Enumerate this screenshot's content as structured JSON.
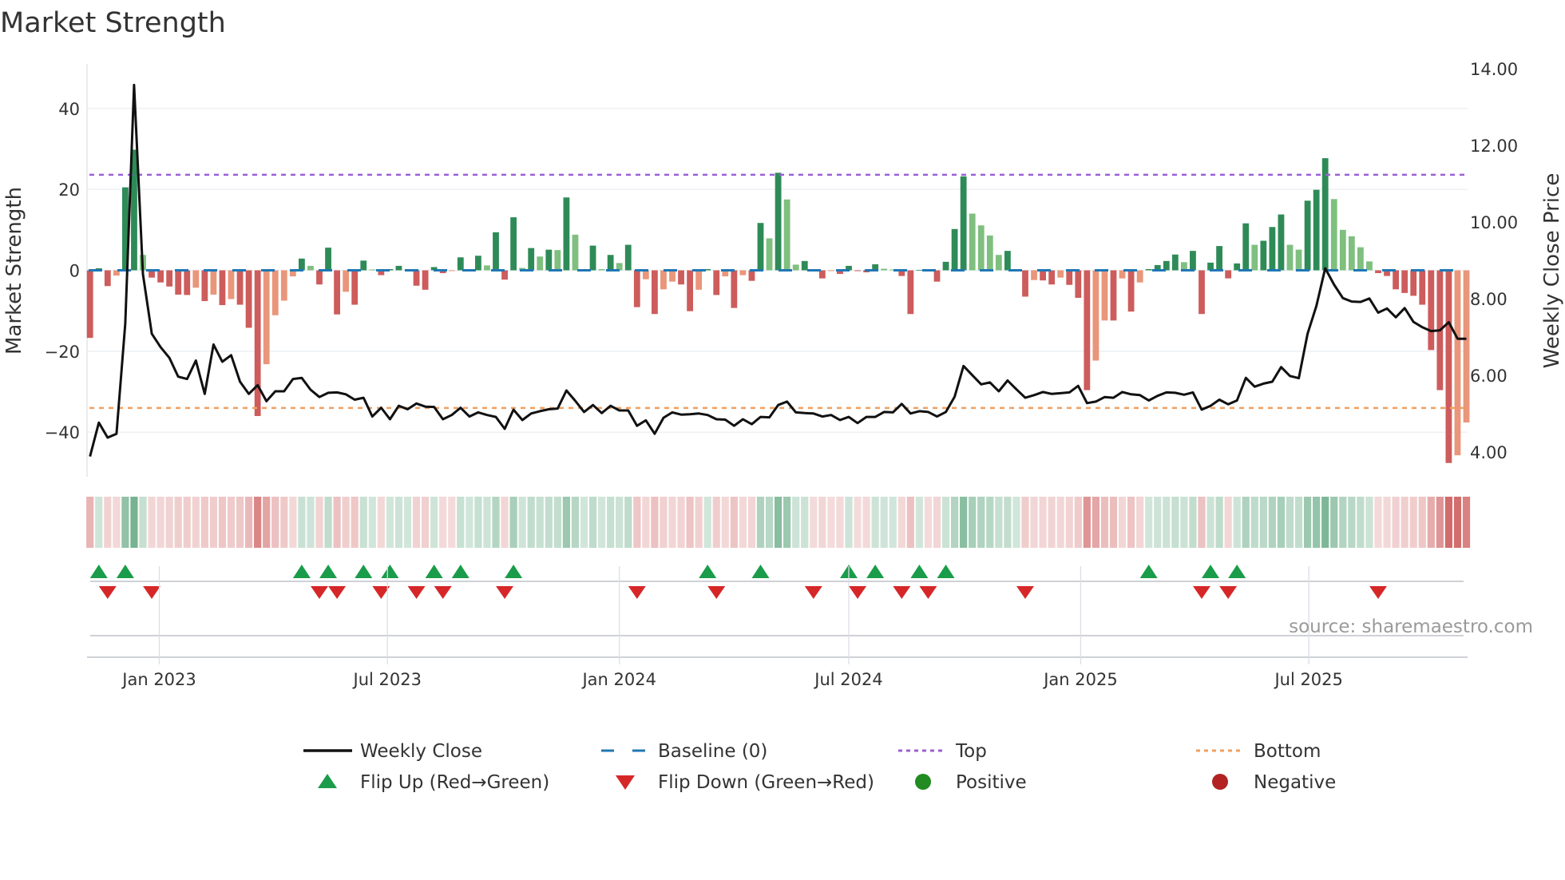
{
  "chart_data": {
    "type": "bar",
    "title": "Market Strength",
    "ylabel": "Market Strength",
    "ylabel_right": "Weekly Close Price",
    "ylim": [
      -51,
      51
    ],
    "ylim_right": [
      3.35,
      14.12
    ],
    "yticks": [
      {
        "value": 40,
        "label": "40"
      },
      {
        "value": 20,
        "label": "20"
      },
      {
        "value": 0,
        "label": "0"
      },
      {
        "value": -20,
        "label": "−20"
      },
      {
        "value": -40,
        "label": "−40"
      }
    ],
    "yticks_right": [
      {
        "value": 14,
        "label": "14.00"
      },
      {
        "value": 12,
        "label": "12.00"
      },
      {
        "value": 10,
        "label": "10.00"
      },
      {
        "value": 8,
        "label": "8.00"
      },
      {
        "value": 6,
        "label": "6.00"
      },
      {
        "value": 4,
        "label": "4.00"
      }
    ],
    "xticks": [
      {
        "date": "2023-01-01",
        "label": "Jan 2023"
      },
      {
        "date": "2023-07-01",
        "label": "Jul 2023"
      },
      {
        "date": "2024-01-01",
        "label": "Jan 2024"
      },
      {
        "date": "2024-07-01",
        "label": "Jul 2024"
      },
      {
        "date": "2025-01-01",
        "label": "Jan 2025"
      },
      {
        "date": "2025-07-01",
        "label": "Jul 2025"
      }
    ],
    "grid": true,
    "legend_position": "bottom",
    "top_level": 23.6,
    "bottom_level": -34.0,
    "baseline_level": 0,
    "weeks": [
      "2022-11-07",
      "2022-11-14",
      "2022-11-21",
      "2022-11-28",
      "2022-12-05",
      "2022-12-12",
      "2022-12-19",
      "2022-12-26",
      "2023-01-02",
      "2023-01-09",
      "2023-01-16",
      "2023-01-23",
      "2023-01-30",
      "2023-02-06",
      "2023-02-13",
      "2023-02-20",
      "2023-02-27",
      "2023-03-06",
      "2023-03-13",
      "2023-03-20",
      "2023-03-27",
      "2023-04-03",
      "2023-04-10",
      "2023-04-17",
      "2023-04-24",
      "2023-05-01",
      "2023-05-08",
      "2023-05-15",
      "2023-05-22",
      "2023-05-29",
      "2023-06-05",
      "2023-06-12",
      "2023-06-19",
      "2023-06-26",
      "2023-07-03",
      "2023-07-10",
      "2023-07-17",
      "2023-07-24",
      "2023-07-31",
      "2023-08-07",
      "2023-08-14",
      "2023-08-21",
      "2023-08-28",
      "2023-09-04",
      "2023-09-11",
      "2023-09-18",
      "2023-09-25",
      "2023-10-02",
      "2023-10-09",
      "2023-10-16",
      "2023-10-23",
      "2023-10-30",
      "2023-11-06",
      "2023-11-13",
      "2023-11-20",
      "2023-11-27",
      "2023-12-04",
      "2023-12-11",
      "2023-12-18",
      "2023-12-25",
      "2024-01-01",
      "2024-01-08",
      "2024-01-15",
      "2024-01-22",
      "2024-01-29",
      "2024-02-05",
      "2024-02-12",
      "2024-02-19",
      "2024-02-26",
      "2024-03-04",
      "2024-03-11",
      "2024-03-18",
      "2024-03-25",
      "2024-04-01",
      "2024-04-08",
      "2024-04-15",
      "2024-04-22",
      "2024-04-29",
      "2024-05-06",
      "2024-05-13",
      "2024-05-20",
      "2024-05-27",
      "2024-06-03",
      "2024-06-10",
      "2024-06-17",
      "2024-06-24",
      "2024-07-01",
      "2024-07-08",
      "2024-07-15",
      "2024-07-22",
      "2024-07-29",
      "2024-08-05",
      "2024-08-12",
      "2024-08-19",
      "2024-08-26",
      "2024-09-02",
      "2024-09-09",
      "2024-09-16",
      "2024-09-23",
      "2024-09-30",
      "2024-10-07",
      "2024-10-14",
      "2024-10-21",
      "2024-10-28",
      "2024-11-04",
      "2024-11-11",
      "2024-11-18",
      "2024-11-25",
      "2024-12-02",
      "2024-12-09",
      "2024-12-16",
      "2024-12-23",
      "2024-12-30",
      "2025-01-06",
      "2025-01-13",
      "2025-01-20",
      "2025-01-27",
      "2025-02-03",
      "2025-02-10",
      "2025-02-17",
      "2025-02-24",
      "2025-03-03",
      "2025-03-10",
      "2025-03-17",
      "2025-03-24",
      "2025-03-31",
      "2025-04-07",
      "2025-04-14",
      "2025-04-21",
      "2025-04-28",
      "2025-05-05",
      "2025-05-12",
      "2025-05-19",
      "2025-05-26",
      "2025-06-02",
      "2025-06-09",
      "2025-06-16",
      "2025-06-23",
      "2025-06-30",
      "2025-07-07",
      "2025-07-14",
      "2025-07-21",
      "2025-07-28",
      "2025-08-04",
      "2025-08-11",
      "2025-08-18",
      "2025-08-25",
      "2025-09-01",
      "2025-09-08",
      "2025-09-15",
      "2025-09-22",
      "2025-09-29",
      "2025-10-06",
      "2025-10-13",
      "2025-10-20",
      "2025-10-27",
      "2025-11-03"
    ],
    "strength": [
      -16.7,
      0.5,
      -3.9,
      -1.3,
      20.5,
      29.8,
      3.8,
      -1.8,
      -3.0,
      -4.0,
      -6.0,
      -6.1,
      -4.3,
      -7.6,
      -6.0,
      -8.6,
      -7.1,
      -8.5,
      -14.2,
      -36.0,
      -23.2,
      -11.1,
      -7.5,
      -1.5,
      2.9,
      1.1,
      -3.5,
      5.6,
      -10.9,
      -5.3,
      -8.5,
      2.4,
      0.2,
      -1.2,
      0.3,
      1.1,
      0.2,
      -3.8,
      -4.8,
      0.8,
      -0.7,
      -0.2,
      3.2,
      0.2,
      3.6,
      1.2,
      9.4,
      -2.3,
      13.1,
      0.6,
      5.5,
      3.4,
      5.1,
      5.0,
      18.0,
      8.8,
      0.2,
      6.1,
      0.3,
      3.8,
      1.8,
      6.3,
      -9.1,
      -2.2,
      -10.8,
      -4.7,
      -2.8,
      -3.5,
      -10.1,
      -4.8,
      0.3,
      -6.1,
      -1.5,
      -9.3,
      -1.2,
      -2.6,
      11.7,
      7.9,
      24.1,
      17.5,
      1.4,
      2.3,
      -0.3,
      -2.0,
      -0.2,
      -0.9,
      1.1,
      -0.2,
      -0.5,
      1.5,
      0.4,
      0.2,
      -1.4,
      -10.8,
      0.1,
      -0.3,
      -2.8,
      2.1,
      10.2,
      23.2,
      14.0,
      11.1,
      8.6,
      3.8,
      4.8,
      0.3,
      -6.5,
      -2.4,
      -2.5,
      -3.5,
      -1.8,
      -3.6,
      -6.8,
      -29.6,
      -22.3,
      -12.4,
      -12.4,
      -2.0,
      -10.2,
      -3.0,
      0.3,
      1.3,
      2.3,
      3.9,
      2.0,
      4.8,
      -10.8,
      1.9,
      6.0,
      -2.0,
      1.7,
      11.6,
      6.3,
      7.3,
      10.7,
      13.8,
      6.3,
      5.1,
      17.2,
      19.9,
      27.7,
      17.6,
      10.0,
      8.4,
      5.7,
      2.2,
      -0.7,
      -1.4,
      -4.7,
      -5.6,
      -6.3,
      -8.5,
      -19.7,
      -29.6,
      -47.6,
      -45.7,
      -37.6
    ],
    "close": [
      3.88,
      4.76,
      4.37,
      4.47,
      7.35,
      13.57,
      8.64,
      7.08,
      6.73,
      6.45,
      5.96,
      5.9,
      6.38,
      5.51,
      6.8,
      6.35,
      6.52,
      5.83,
      5.51,
      5.74,
      5.32,
      5.58,
      5.58,
      5.9,
      5.93,
      5.62,
      5.43,
      5.54,
      5.55,
      5.5,
      5.36,
      5.41,
      4.92,
      5.15,
      4.85,
      5.2,
      5.11,
      5.26,
      5.18,
      5.17,
      4.85,
      4.96,
      5.15,
      4.92,
      5.03,
      4.96,
      4.91,
      4.6,
      5.1,
      4.83,
      5.0,
      5.06,
      5.11,
      5.13,
      5.6,
      5.33,
      5.04,
      5.22,
      5.01,
      5.2,
      5.08,
      5.08,
      4.68,
      4.82,
      4.47,
      4.89,
      5.03,
      4.97,
      4.98,
      5.0,
      4.96,
      4.85,
      4.84,
      4.68,
      4.85,
      4.72,
      4.91,
      4.9,
      5.22,
      5.31,
      5.03,
      5.01,
      5.0,
      4.92,
      4.96,
      4.83,
      4.91,
      4.75,
      4.91,
      4.91,
      5.04,
      5.03,
      5.25,
      5.0,
      5.06,
      5.04,
      4.92,
      5.04,
      5.44,
      6.24,
      6.0,
      5.76,
      5.81,
      5.58,
      5.86,
      5.63,
      5.41,
      5.48,
      5.56,
      5.51,
      5.53,
      5.55,
      5.72,
      5.27,
      5.31,
      5.43,
      5.41,
      5.56,
      5.5,
      5.48,
      5.34,
      5.46,
      5.55,
      5.54,
      5.49,
      5.55,
      5.1,
      5.2,
      5.36,
      5.24,
      5.34,
      5.93,
      5.7,
      5.78,
      5.83,
      6.21,
      5.98,
      5.92,
      7.08,
      7.81,
      8.79,
      8.36,
      8.01,
      7.92,
      7.91,
      8.0,
      7.63,
      7.74,
      7.51,
      7.75,
      7.39,
      7.25,
      7.15,
      7.17,
      7.38,
      6.95,
      6.95
    ],
    "legend": [
      {
        "key": "close",
        "label": "Weekly Close",
        "symbol": "line"
      },
      {
        "key": "baseline",
        "label": "Baseline (0)",
        "symbol": "dash"
      },
      {
        "key": "top",
        "label": "Top",
        "symbol": "dots"
      },
      {
        "key": "bottom",
        "label": "Bottom",
        "symbol": "dots"
      },
      {
        "key": "flip_up",
        "label": "Flip Up (Red→Green)",
        "symbol": "triangle-up"
      },
      {
        "key": "flip_down",
        "label": "Flip Down (Green→Red)",
        "symbol": "triangle-down"
      },
      {
        "key": "positive",
        "label": "Positive",
        "symbol": "circle"
      },
      {
        "key": "negative",
        "label": "Negative",
        "symbol": "circle"
      }
    ],
    "colors": {
      "positive_strong": "#2e8b57",
      "positive_weak": "#7fbf7f",
      "negative_strong": "#cd5c5c",
      "negative_weak": "#e9967a",
      "close": "#111111",
      "baseline": "#1f77b4",
      "top": "#9b5fd6",
      "bottom": "#f0a060",
      "flip_up": "#1a9c4a",
      "flip_down": "#d62728",
      "positive": "#228b22",
      "negative": "#b22222",
      "heat_positive": "#2e8b57",
      "heat_negative": "#cd5c5c"
    },
    "source": "source: sharemaestro.com"
  }
}
